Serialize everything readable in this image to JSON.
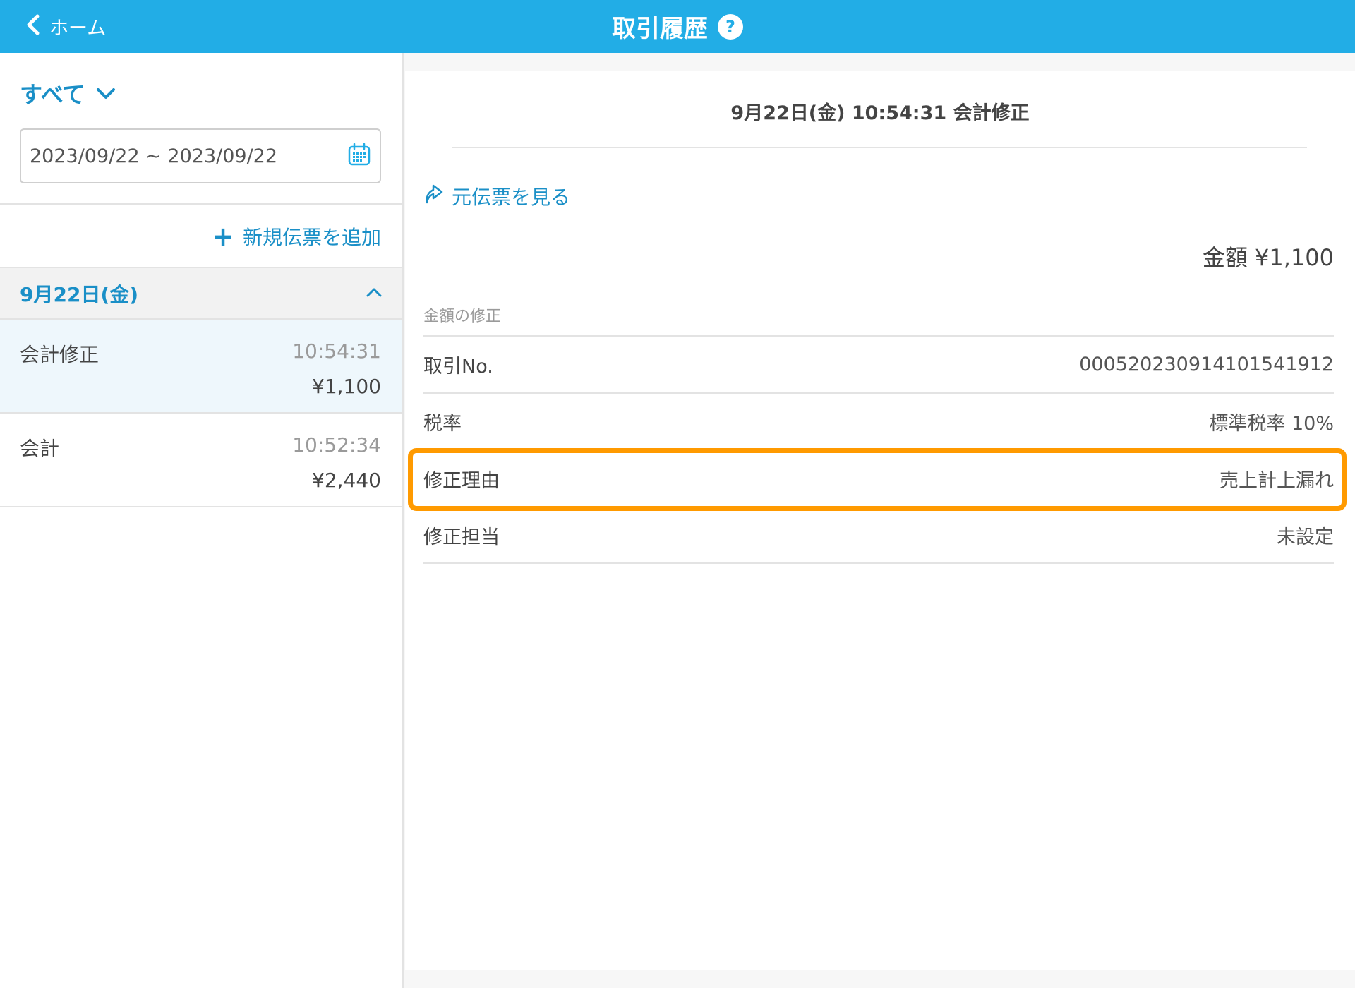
{
  "header": {
    "back_label": "ホーム",
    "title": "取引履歴",
    "help": "?"
  },
  "sidebar": {
    "filter_label": "すべて",
    "date_range": "2023/09/22 ~ 2023/09/22",
    "add_button": "新規伝票を追加",
    "add_plus": "+",
    "date_group": "9月22日(金)",
    "transactions": [
      {
        "type": "会計修正",
        "time": "10:54:31",
        "amount": "¥1,100"
      },
      {
        "type": "会計",
        "time": "10:52:34",
        "amount": "¥2,440"
      }
    ]
  },
  "detail": {
    "title": "9月22日(金) 10:54:31 会計修正",
    "original_link": "元伝票を見る",
    "amount": "金額 ¥1,100",
    "section_label": "金額の修正",
    "rows": [
      {
        "label": "取引No.",
        "value": "00052023091410154191​2"
      },
      {
        "label": "税率",
        "value": "標準税率 10%"
      },
      {
        "label": "修正理由",
        "value": "売上計上漏れ"
      },
      {
        "label": "修正担当",
        "value": "未設定"
      }
    ]
  },
  "colors": {
    "header": "#22ade6",
    "accent": "#1a8fc7",
    "highlight": "#ff9a00"
  }
}
